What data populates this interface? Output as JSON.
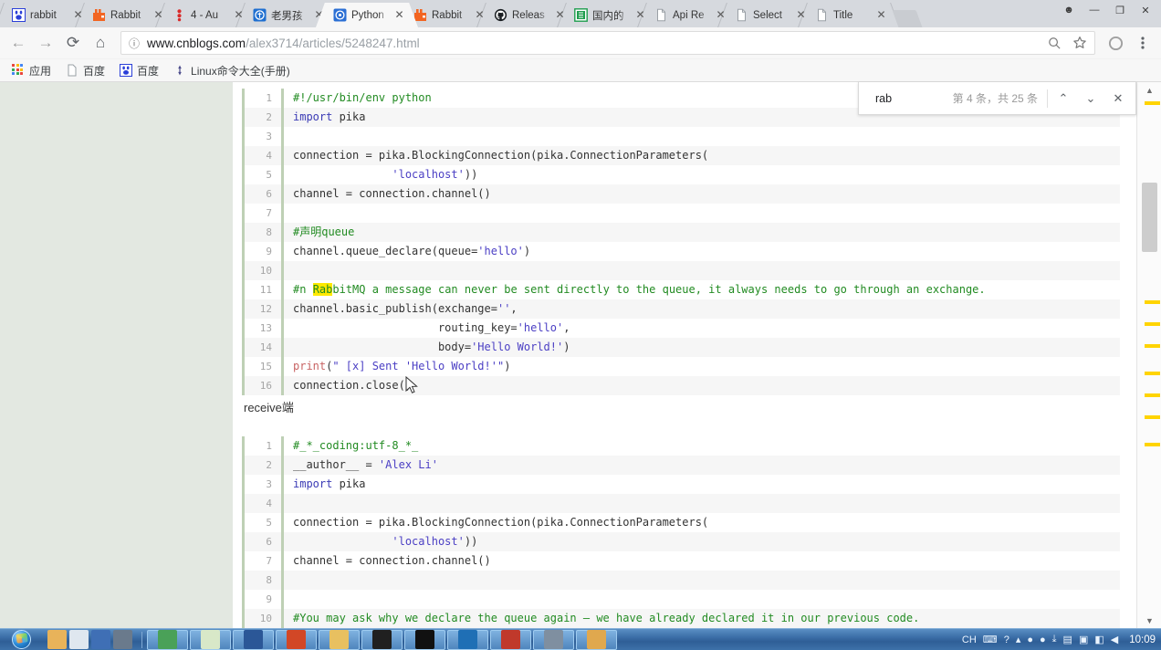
{
  "browser": {
    "tabs": [
      {
        "label": "rabbit",
        "icon": "baidu-paw-icon",
        "active": false
      },
      {
        "label": "Rabbit",
        "icon": "rabbitmq-icon",
        "active": false
      },
      {
        "label": "4 - Au",
        "icon": "dots-red-icon",
        "active": false
      },
      {
        "label": "老男孩",
        "icon": "oldboy-icon",
        "active": false
      },
      {
        "label": "Python",
        "icon": "cnblogs-icon",
        "active": true
      },
      {
        "label": "Rabbit",
        "icon": "rabbitmq-icon",
        "active": false
      },
      {
        "label": "Releas",
        "icon": "github-icon",
        "active": false
      },
      {
        "label": "国内的",
        "icon": "green-doc-icon",
        "active": false
      },
      {
        "label": "Api Re",
        "icon": "page-icon",
        "active": false
      },
      {
        "label": "Select",
        "icon": "page-icon",
        "active": false
      },
      {
        "label": "Title",
        "icon": "page-icon",
        "active": false
      }
    ],
    "tab_close_label": "✕",
    "window_controls": [
      {
        "name": "user-avatar-button",
        "glyph": "☻"
      },
      {
        "name": "minimize-button",
        "glyph": "—"
      },
      {
        "name": "maximize-button",
        "glyph": "❐"
      },
      {
        "name": "close-button",
        "glyph": "✕"
      }
    ],
    "nav": {
      "back": "←",
      "forward": "→",
      "reload": "⟳",
      "home": "⌂"
    },
    "omnibox": {
      "info_icon": "ⓘ",
      "url_host": "www.cnblogs.com",
      "url_path": "/alex3714/articles/5248247.html",
      "zoom_icon": "search-icon",
      "star_icon": "star-icon"
    },
    "toolbar_right": {
      "profile_icon": "profile-circle-icon",
      "menu_icon": "three-dot-menu-icon"
    },
    "bookmarks": [
      {
        "label": "应用",
        "icon": "apps-grid-icon"
      },
      {
        "label": "百度",
        "icon": "page-icon"
      },
      {
        "label": "百度",
        "icon": "baidu-paw-icon"
      },
      {
        "label": "Linux命令大全(手册)",
        "icon": "compass-icon"
      }
    ]
  },
  "findbar": {
    "query": "rab",
    "count_text": "第 4 条，共 25 条",
    "prev_label": "⌃",
    "next_label": "⌄",
    "close_label": "✕"
  },
  "page": {
    "middle_label": "receive端",
    "code_block_1": [
      {
        "n": "1",
        "segs": [
          {
            "t": "#!/usr/bin/env python",
            "c": "k-com"
          }
        ]
      },
      {
        "n": "2",
        "segs": [
          {
            "t": "import",
            "c": "k-var"
          },
          {
            "t": " pika",
            "c": ""
          }
        ]
      },
      {
        "n": "3",
        "segs": [
          {
            "t": "",
            "c": ""
          }
        ]
      },
      {
        "n": "4",
        "segs": [
          {
            "t": "connection = pika.BlockingConnection(pika.ConnectionParameters(",
            "c": ""
          }
        ]
      },
      {
        "n": "5",
        "segs": [
          {
            "t": "               ",
            "c": ""
          },
          {
            "t": "'localhost'",
            "c": "k-str"
          },
          {
            "t": "))",
            "c": ""
          }
        ]
      },
      {
        "n": "6",
        "segs": [
          {
            "t": "channel = connection.channel()",
            "c": ""
          }
        ]
      },
      {
        "n": "7",
        "segs": [
          {
            "t": "",
            "c": ""
          }
        ]
      },
      {
        "n": "8",
        "segs": [
          {
            "t": "#声明queue",
            "c": "k-com"
          }
        ]
      },
      {
        "n": "9",
        "segs": [
          {
            "t": "channel.queue_declare(queue=",
            "c": ""
          },
          {
            "t": "'hello'",
            "c": "k-str"
          },
          {
            "t": ")",
            "c": ""
          }
        ]
      },
      {
        "n": "10",
        "segs": [
          {
            "t": "",
            "c": ""
          }
        ]
      },
      {
        "n": "11",
        "segs": [
          {
            "t": "#n ",
            "c": "k-com"
          },
          {
            "t": "Rab",
            "c": "k-com hl"
          },
          {
            "t": "bitMQ a message can never be sent directly to the queue, it always needs to go through an exchange.",
            "c": "k-com"
          }
        ]
      },
      {
        "n": "12",
        "segs": [
          {
            "t": "channel.basic_publish(exchange=",
            "c": ""
          },
          {
            "t": "''",
            "c": "k-str"
          },
          {
            "t": ",",
            "c": ""
          }
        ]
      },
      {
        "n": "13",
        "segs": [
          {
            "t": "                      routing_key=",
            "c": ""
          },
          {
            "t": "'hello'",
            "c": "k-str"
          },
          {
            "t": ",",
            "c": ""
          }
        ]
      },
      {
        "n": "14",
        "segs": [
          {
            "t": "                      body=",
            "c": ""
          },
          {
            "t": "'Hello World!'",
            "c": "k-str"
          },
          {
            "t": ")",
            "c": ""
          }
        ]
      },
      {
        "n": "15",
        "segs": [
          {
            "t": "print",
            "c": "k-fn"
          },
          {
            "t": "(",
            "c": ""
          },
          {
            "t": "\" [x] Sent 'Hello World!'\"",
            "c": "k-str"
          },
          {
            "t": ")",
            "c": ""
          }
        ]
      },
      {
        "n": "16",
        "segs": [
          {
            "t": "connection.close()",
            "c": ""
          }
        ]
      }
    ],
    "code_block_2": [
      {
        "n": "1",
        "segs": [
          {
            "t": "#_*_coding:utf-8_*_",
            "c": "k-com"
          }
        ]
      },
      {
        "n": "2",
        "segs": [
          {
            "t": "__author__ = ",
            "c": ""
          },
          {
            "t": "'Alex Li'",
            "c": "k-str"
          }
        ]
      },
      {
        "n": "3",
        "segs": [
          {
            "t": "import",
            "c": "k-var"
          },
          {
            "t": " pika",
            "c": ""
          }
        ]
      },
      {
        "n": "4",
        "segs": [
          {
            "t": "",
            "c": ""
          }
        ]
      },
      {
        "n": "5",
        "segs": [
          {
            "t": "connection = pika.BlockingConnection(pika.ConnectionParameters(",
            "c": ""
          }
        ]
      },
      {
        "n": "6",
        "segs": [
          {
            "t": "               ",
            "c": ""
          },
          {
            "t": "'localhost'",
            "c": "k-str"
          },
          {
            "t": "))",
            "c": ""
          }
        ]
      },
      {
        "n": "7",
        "segs": [
          {
            "t": "channel = connection.channel()",
            "c": ""
          }
        ]
      },
      {
        "n": "8",
        "segs": [
          {
            "t": "",
            "c": ""
          }
        ]
      },
      {
        "n": "9",
        "segs": [
          {
            "t": "",
            "c": ""
          }
        ]
      },
      {
        "n": "10",
        "segs": [
          {
            "t": "#You may ask why we declare the queue again – we have already declared it in our previous code.",
            "c": "k-com"
          }
        ]
      }
    ]
  },
  "scrollbar": {
    "up_arrow": "▲",
    "down_arrow": "▼",
    "ticks_pct": [
      3.5,
      40,
      44,
      48,
      53,
      57,
      61,
      66
    ]
  },
  "taskbar": {
    "start_label": "start-orb",
    "quicklaunch": [
      {
        "name": "paint-icon",
        "color": "#e8b35a"
      },
      {
        "name": "snip-icon",
        "color": "#dfe7ef"
      },
      {
        "name": "save-icon",
        "color": "#3f6fb5"
      },
      {
        "name": "tool-icon",
        "color": "#6a7a8c"
      }
    ],
    "tasks": [
      {
        "name": "chrome-task",
        "color": "#4aa158"
      },
      {
        "name": "notepad-task",
        "color": "#d8e8c8"
      },
      {
        "name": "word-task",
        "color": "#2b5797"
      },
      {
        "name": "powerpoint-task",
        "color": "#d24726"
      },
      {
        "name": "explorer-task",
        "color": "#e8c060"
      },
      {
        "name": "pycharm-task",
        "color": "#202020"
      },
      {
        "name": "cmd-task",
        "color": "#111111"
      },
      {
        "name": "xshell-task",
        "color": "#1f6fb5"
      },
      {
        "name": "mysql-task",
        "color": "#c0392b"
      },
      {
        "name": "media-task",
        "color": "#7f8fa0"
      },
      {
        "name": "folder-task",
        "color": "#e0a84e"
      }
    ],
    "tray": [
      {
        "name": "ime-indicator",
        "glyph": "CH"
      },
      {
        "name": "keyboard-icon",
        "glyph": "⌨"
      },
      {
        "name": "help-icon",
        "glyph": "?"
      },
      {
        "name": "show-hidden-icon",
        "glyph": "▴"
      },
      {
        "name": "antivirus-icon",
        "glyph": "●"
      },
      {
        "name": "shield-icon",
        "glyph": "●"
      },
      {
        "name": "download-icon",
        "glyph": "⤓"
      },
      {
        "name": "network-icon",
        "glyph": "▤"
      },
      {
        "name": "monitor-icon",
        "glyph": "▣"
      },
      {
        "name": "app-icon",
        "glyph": "◧"
      },
      {
        "name": "volume-icon",
        "glyph": "◀"
      }
    ],
    "clock": "10:09"
  }
}
